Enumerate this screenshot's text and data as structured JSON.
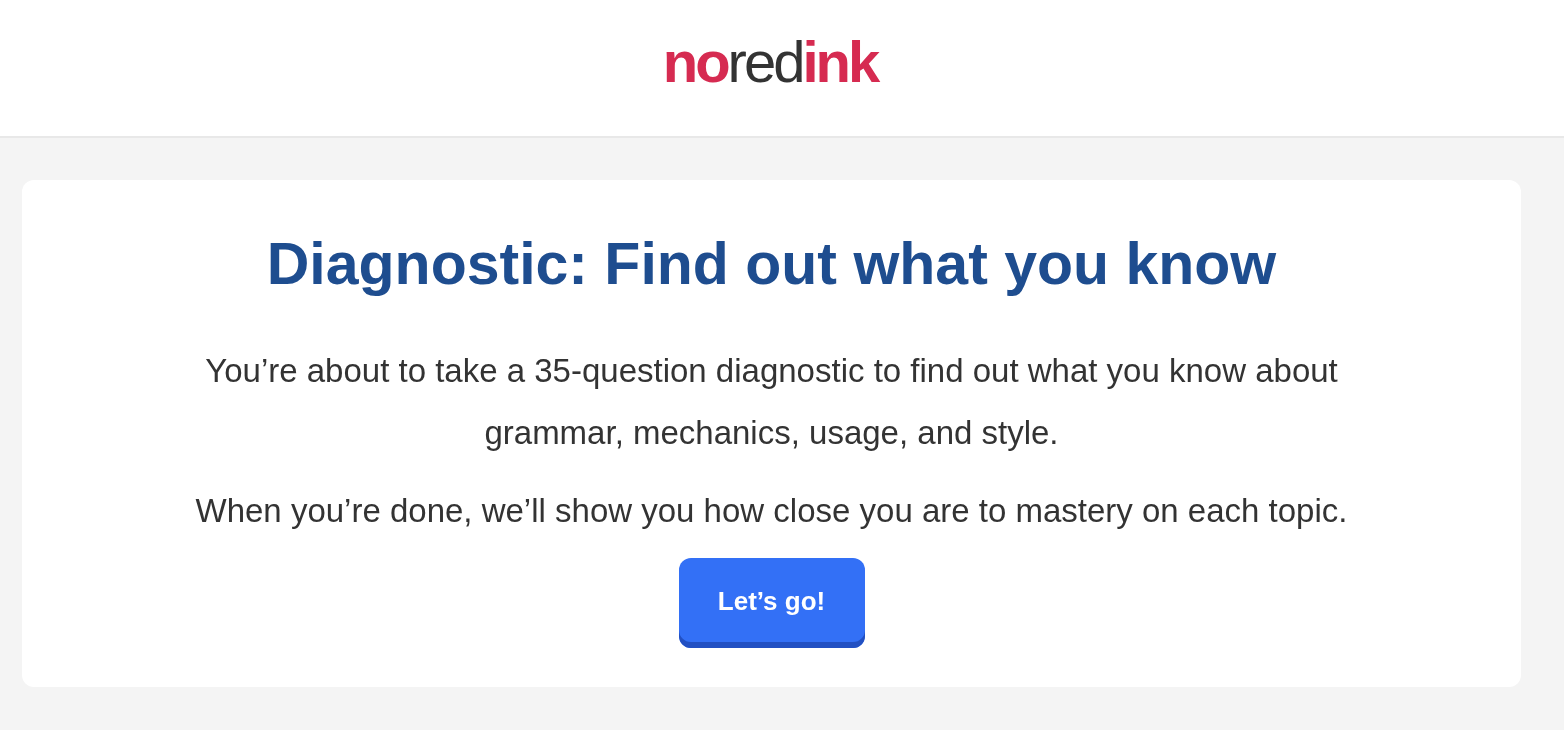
{
  "header": {
    "logo": "**no**red**ink**"
  },
  "card": {
    "title": "Diagnostic: Find out what you know",
    "paragraphs": [
      "You’re about to take a 35-question diagnostic to find out what you know about grammar, mechanics, usage, and style.",
      "When you’re done, we’ll show you how close you are to mastery on each topic."
    ],
    "button": {
      "label": "Let’s go!"
    }
  }
}
